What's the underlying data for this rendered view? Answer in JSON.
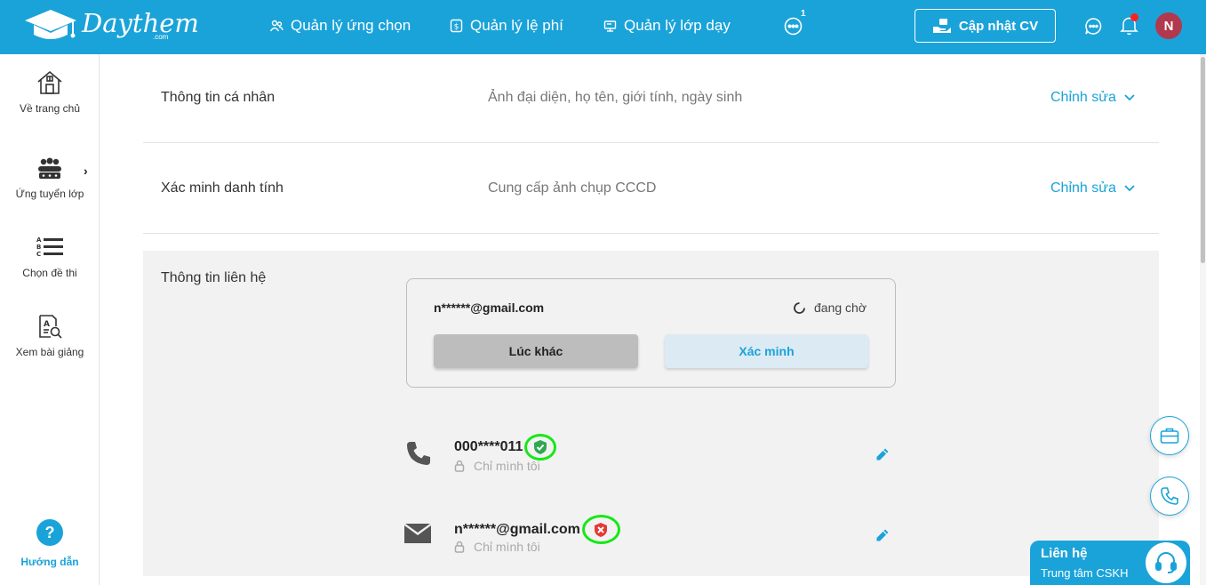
{
  "header": {
    "logo_text": "Daythem",
    "logo_sub": ".com",
    "nav": [
      {
        "label": "Quản lý ứng chọn",
        "icon": "users-icon"
      },
      {
        "label": "Quản lý lệ phí",
        "icon": "fee-icon"
      },
      {
        "label": "Quản lý lớp dạy",
        "icon": "class-icon"
      }
    ],
    "more_badge": "1",
    "cv_button": "Cập nhật CV",
    "avatar_initial": "N",
    "accent_color": "#1aa3d9"
  },
  "sidebar": {
    "items": [
      {
        "label": "Về trang chủ",
        "icon": "home-icon"
      },
      {
        "label": "Ứng tuyển lớp",
        "icon": "group-icon"
      },
      {
        "label": "Chọn đề thi",
        "icon": "abc-list-icon"
      },
      {
        "label": "Xem bài giảng",
        "icon": "lesson-search-icon"
      }
    ],
    "help_symbol": "?",
    "help_label": "Hướng dẫn"
  },
  "sections": [
    {
      "title": "Thông tin cá nhân",
      "desc": "Ảnh đại diện, họ tên, giới tính, ngày sinh",
      "edit": "Chỉnh sửa"
    },
    {
      "title": "Xác minh danh tính",
      "desc": "Cung cấp ảnh chụp CCCD",
      "edit": "Chỉnh sửa"
    }
  ],
  "contact": {
    "title": "Thông tin liên hệ",
    "verify": {
      "email": "n******@gmail.com",
      "status": "đang chờ",
      "later_button": "Lúc khác",
      "verify_button": "Xác minh"
    },
    "items": [
      {
        "value": "000****011",
        "privacy": "Chỉ mình tôi",
        "verified": true
      },
      {
        "value": "n******@gmail.com",
        "privacy": "Chỉ mình tôi",
        "verified": false
      }
    ]
  },
  "support": {
    "title": "Liên hệ",
    "subtitle": "Trung tâm CSKH"
  }
}
